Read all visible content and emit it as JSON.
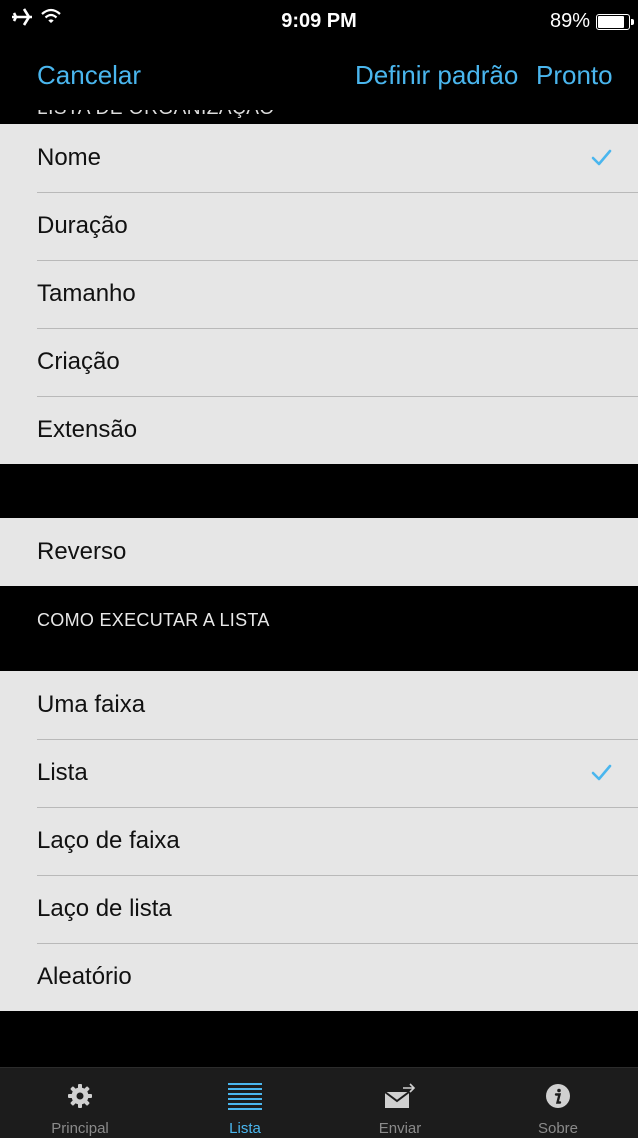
{
  "status_bar": {
    "time": "9:09 PM",
    "battery_percent": "89%",
    "battery_level": 0.89
  },
  "nav": {
    "cancel_label": "Cancelar",
    "set_default_label": "Definir padrão",
    "done_label": "Pronto"
  },
  "sort_section": {
    "header": "LISTA DE ORGANIZAÇÃO",
    "options": [
      {
        "label": "Nome",
        "checked": true
      },
      {
        "label": "Duração",
        "checked": false
      },
      {
        "label": "Tamanho",
        "checked": false
      },
      {
        "label": "Criação",
        "checked": false
      },
      {
        "label": "Extensão",
        "checked": false
      }
    ]
  },
  "reverse_section": {
    "label": "Reverso"
  },
  "play_section": {
    "header": "COMO EXECUTAR A LISTA",
    "options": [
      {
        "label": "Uma faixa",
        "checked": false
      },
      {
        "label": "Lista",
        "checked": true
      },
      {
        "label": "Laço de faixa",
        "checked": false
      },
      {
        "label": "Laço de lista",
        "checked": false
      },
      {
        "label": "Aleatório",
        "checked": false
      }
    ]
  },
  "tabs": [
    {
      "label": "Principal",
      "icon": "gear-icon",
      "active": false
    },
    {
      "label": "Lista",
      "icon": "list-icon",
      "active": true
    },
    {
      "label": "Enviar",
      "icon": "send-mail-icon",
      "active": false
    },
    {
      "label": "Sobre",
      "icon": "info-icon",
      "active": false
    }
  ],
  "colors": {
    "accent": "#4ab6ee",
    "row_bg": "#e6e6e6",
    "background": "#000000"
  }
}
